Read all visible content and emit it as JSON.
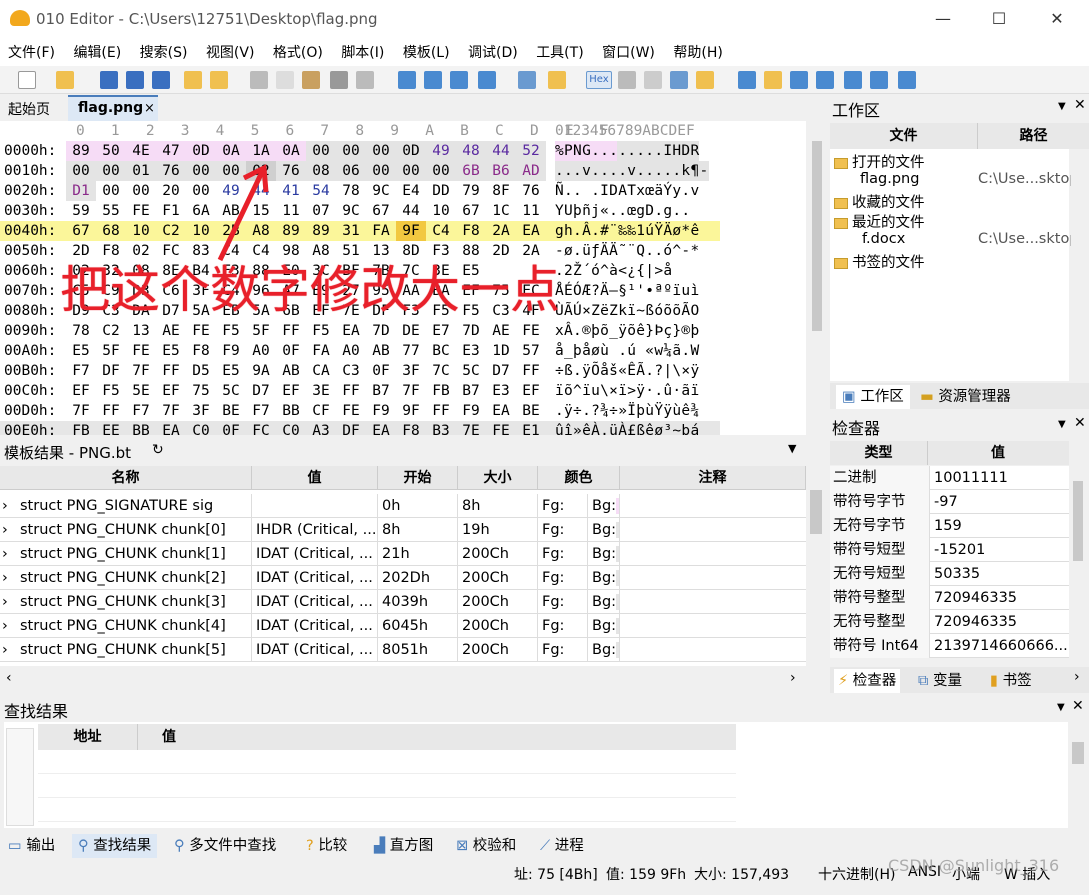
{
  "window": {
    "title": "010 Editor - C:\\Users\\12751\\Desktop\\flag.png",
    "minimize": "—",
    "maximize": "☐",
    "close": "✕"
  },
  "menu": [
    "文件(F)",
    "编辑(E)",
    "搜索(S)",
    "视图(V)",
    "格式(O)",
    "脚本(I)",
    "模板(L)",
    "调试(D)",
    "工具(T)",
    "窗口(W)",
    "帮助(H)"
  ],
  "tabs": {
    "home": "起始页",
    "file": "flag.png",
    "close": "×"
  },
  "toolbar": {
    "hex": "Hex"
  },
  "hex": {
    "col_header": "0   1   2   3   4   5   6   7   8   9   A   B   C   D   E   F",
    "ascii_header": "0123456789ABCDEF",
    "rows": [
      {
        "addr": "0000h:",
        "bytes": [
          "89",
          "50",
          "4E",
          "47",
          "0D",
          "0A",
          "1A",
          "0A",
          "00",
          "00",
          "00",
          "0D",
          "49",
          "48",
          "44",
          "52"
        ],
        "ascii": "%PNG........IHDR"
      },
      {
        "addr": "0010h:",
        "bytes": [
          "00",
          "00",
          "01",
          "76",
          "00",
          "00",
          "02",
          "76",
          "08",
          "06",
          "00",
          "00",
          "00",
          "6B",
          "B6",
          "AD"
        ],
        "ascii": "...v....v.....k¶-"
      },
      {
        "addr": "0020h:",
        "bytes": [
          "D1",
          "00",
          "00",
          "20",
          "00",
          "49",
          "44",
          "41",
          "54",
          "78",
          "9C",
          "E4",
          "DD",
          "79",
          "8F",
          "76"
        ],
        "ascii": "Ñ.. .IDATxœäÝy.v"
      },
      {
        "addr": "0030h:",
        "bytes": [
          "59",
          "55",
          "FE",
          "F1",
          "6A",
          "AB",
          "15",
          "11",
          "07",
          "9C",
          "67",
          "44",
          "10",
          "67",
          "1C",
          "11"
        ],
        "ascii": "YUþñj«..œgD.g.."
      },
      {
        "addr": "0040h:",
        "bytes": [
          "67",
          "68",
          "10",
          "C2",
          "10",
          "2B",
          "A8",
          "89",
          "89",
          "31",
          "FA",
          "9F",
          "C4",
          "F8",
          "2A",
          "EA"
        ],
        "ascii": "gh.Â.#¨‰‰1úŸÄø*ê"
      },
      {
        "addr": "0050h:",
        "bytes": [
          "2D",
          "F8",
          "02",
          "FC",
          "83",
          "C4",
          "C4",
          "98",
          "A8",
          "51",
          "13",
          "8D",
          "F3",
          "88",
          "2D",
          "2A"
        ],
        "ascii": "-ø.üƒÄÄ˜¨Q..ó^-*"
      },
      {
        "addr": "0060h:",
        "bytes": [
          "02",
          "32",
          "08",
          "8E",
          "B4",
          "F3",
          "88",
          "E0",
          "3C",
          "BF",
          "7B",
          "7C",
          "3E",
          "E5"
        ],
        "ascii": ".2Ž´ó^à<¿{|>å"
      },
      {
        "addr": "0070h:",
        "bytes": [
          "C5",
          "C9",
          "D3",
          "C6",
          "3F",
          "C4",
          "96",
          "A7",
          "B9",
          "27",
          "95",
          "AA",
          "BA",
          "EF",
          "75",
          "EC"
        ],
        "ascii": "ÅÉÓÆ?Ä–§¹'•ªºïuì"
      },
      {
        "addr": "0080h:",
        "bytes": [
          "D9",
          "C3",
          "DA",
          "D7",
          "5A",
          "EB",
          "5A",
          "6B",
          "EF",
          "7E",
          "DF",
          "F3",
          "F5",
          "F5",
          "C3",
          "4F"
        ],
        "ascii": "ÙÃÚ×ZëZkï~ßóõõÃO"
      },
      {
        "addr": "0090h:",
        "bytes": [
          "78",
          "C2",
          "13",
          "AE",
          "FE",
          "F5",
          "5F",
          "FF",
          "F5",
          "EA",
          "7D",
          "DE",
          "E7",
          "7D",
          "AE",
          "FE"
        ],
        "ascii": "xÂ.®þõ_ÿõê}Þç}®þ"
      },
      {
        "addr": "00A0h:",
        "bytes": [
          "E5",
          "5F",
          "FE",
          "E5",
          "F8",
          "F9",
          "A0",
          "0F",
          "FA",
          "A0",
          "AB",
          "77",
          "BC",
          "E3",
          "1D",
          "57"
        ],
        "ascii": "å_þåøù .ú «w¼ã.W"
      },
      {
        "addr": "00B0h:",
        "bytes": [
          "F7",
          "DF",
          "7F",
          "FF",
          "D5",
          "E5",
          "9A",
          "AB",
          "CA",
          "C3",
          "0F",
          "3F",
          "7C",
          "5C",
          "D7",
          "FF"
        ],
        "ascii": "÷ß.ÿÕåš«ÊÃ.?|\\×ÿ"
      },
      {
        "addr": "00C0h:",
        "bytes": [
          "EF",
          "F5",
          "5E",
          "EF",
          "75",
          "5C",
          "D7",
          "EF",
          "3E",
          "FF",
          "B7",
          "7F",
          "FB",
          "B7",
          "E3",
          "EF"
        ],
        "ascii": "ïõ^ïu\\×ï>ÿ·.û·ãï"
      },
      {
        "addr": "00D0h:",
        "bytes": [
          "7F",
          "FF",
          "F7",
          "7F",
          "3F",
          "BE",
          "F7",
          "BB",
          "CF",
          "FE",
          "F9",
          "9F",
          "FF",
          "F9",
          "EA",
          "BE"
        ],
        "ascii": ".ÿ÷.?¾÷»ÏþùŸÿùê¾"
      },
      {
        "addr": "00E0h:",
        "bytes": [
          "FB",
          "EE",
          "BB",
          "EA",
          "C0",
          "0F",
          "FC",
          "C0",
          "A3",
          "DF",
          "EA",
          "F8",
          "B3",
          "7E",
          "FE",
          "E1"
        ],
        "ascii": "ûî»êÀ.üÀ£ßêø³~þá"
      }
    ]
  },
  "annotation": "把这个数字修改大一点",
  "template": {
    "title": "模板结果 - PNG.bt",
    "refresh_icon": "↻",
    "columns": [
      "名称",
      "值",
      "开始",
      "大小",
      "颜色",
      "注释"
    ],
    "rows": [
      {
        "name": "struct PNG_SIGNATURE sig",
        "value": "",
        "start": "0h",
        "size": "8h",
        "fg": "Fg:",
        "bg": "Bg:"
      },
      {
        "name": "struct PNG_CHUNK chunk[0]",
        "value": "IHDR  (Critical, ...",
        "start": "8h",
        "size": "19h",
        "fg": "Fg:",
        "bg": "Bg:"
      },
      {
        "name": "struct PNG_CHUNK chunk[1]",
        "value": "IDAT  (Critical, ...",
        "start": "21h",
        "size": "200Ch",
        "fg": "Fg:",
        "bg": "Bg:"
      },
      {
        "name": "struct PNG_CHUNK chunk[2]",
        "value": "IDAT  (Critical, ...",
        "start": "202Dh",
        "size": "200Ch",
        "fg": "Fg:",
        "bg": "Bg:"
      },
      {
        "name": "struct PNG_CHUNK chunk[3]",
        "value": "IDAT  (Critical, ...",
        "start": "4039h",
        "size": "200Ch",
        "fg": "Fg:",
        "bg": "Bg:"
      },
      {
        "name": "struct PNG_CHUNK chunk[4]",
        "value": "IDAT  (Critical, ...",
        "start": "6045h",
        "size": "200Ch",
        "fg": "Fg:",
        "bg": "Bg:"
      },
      {
        "name": "struct PNG_CHUNK chunk[5]",
        "value": "IDAT  (Critical, ...",
        "start": "8051h",
        "size": "200Ch",
        "fg": "Fg:",
        "bg": "Bg:"
      }
    ]
  },
  "workspace": {
    "title": "工作区",
    "col_file": "文件",
    "col_path": "路径",
    "open_files": "打开的文件",
    "flag_png": "flag.png",
    "flag_path": "C:\\Use...sktop\\",
    "favorites": "收藏的文件",
    "recent": "最近的文件",
    "f_docx": "f.docx",
    "f_path": "C:\\Use...sktop\\",
    "bookmarks": "书签的文件",
    "tab_workspace": "工作区",
    "tab_explorer": "资源管理器"
  },
  "inspector": {
    "title": "检查器",
    "col_type": "类型",
    "col_value": "值",
    "rows": [
      {
        "type": "二进制",
        "value": "10011111"
      },
      {
        "type": "带符号字节",
        "value": "-97"
      },
      {
        "type": "无符号字节",
        "value": "159"
      },
      {
        "type": "带符号短型",
        "value": "-15201"
      },
      {
        "type": "无符号短型",
        "value": "50335"
      },
      {
        "type": "带符号整型",
        "value": "720946335"
      },
      {
        "type": "无符号整型",
        "value": "720946335"
      },
      {
        "type": "带符号 Int64",
        "value": "2139714660666..."
      }
    ],
    "tab_inspector": "检查器",
    "tab_vars": "变量",
    "tab_bookmarks": "书签"
  },
  "find": {
    "title": "查找结果",
    "col_addr": "地址",
    "col_value": "值"
  },
  "bottom_tabs": [
    "输出",
    "查找结果",
    "多文件中查找",
    "比较",
    "直方图",
    "校验和",
    "进程"
  ],
  "status": {
    "addr": "址: 75 [4Bh]",
    "value": "值: 159 9Fh",
    "size": "大小: 157,493",
    "mode": "十六进制(H)",
    "encoding": "ANSI",
    "endian": "小端",
    "insert": "W  插入",
    "watermark": "CSDN @Sunlight_316"
  }
}
